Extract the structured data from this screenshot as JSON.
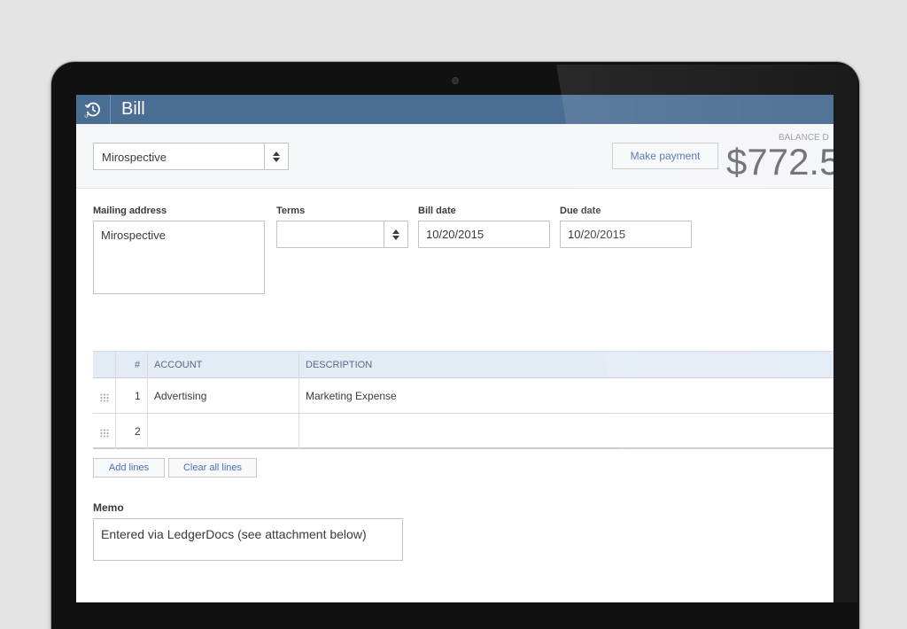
{
  "app": {
    "title": "Bill"
  },
  "icons": {
    "logo": "history-clock-icon",
    "sort": "sort-arrows-icon",
    "drag": "drag-handle-icon"
  },
  "colors": {
    "topbar": "#4a6d93",
    "link": "#4a6fb5",
    "table_header": "#e3ebf5"
  },
  "header": {
    "vendor_value": "Mirospective",
    "make_payment_label": "Make payment",
    "balance_label": "BALANCE D",
    "balance_amount": "$772.5"
  },
  "form": {
    "mailing_address_label": "Mailing address",
    "mailing_address_value": "Mirospective",
    "terms_label": "Terms",
    "terms_value": "",
    "bill_date_label": "Bill date",
    "bill_date_value": "10/20/2015",
    "due_date_label": "Due date",
    "due_date_value": "10/20/2015"
  },
  "table": {
    "columns": [
      "#",
      "ACCOUNT",
      "DESCRIPTION"
    ],
    "rows": [
      {
        "num": "1",
        "account": "Advertising",
        "description": "Marketing Expense"
      },
      {
        "num": "2",
        "account": "",
        "description": ""
      }
    ],
    "add_lines_label": "Add lines",
    "clear_lines_label": "Clear all lines"
  },
  "memo": {
    "label": "Memo",
    "value": "Entered via LedgerDocs (see attachment below)"
  }
}
